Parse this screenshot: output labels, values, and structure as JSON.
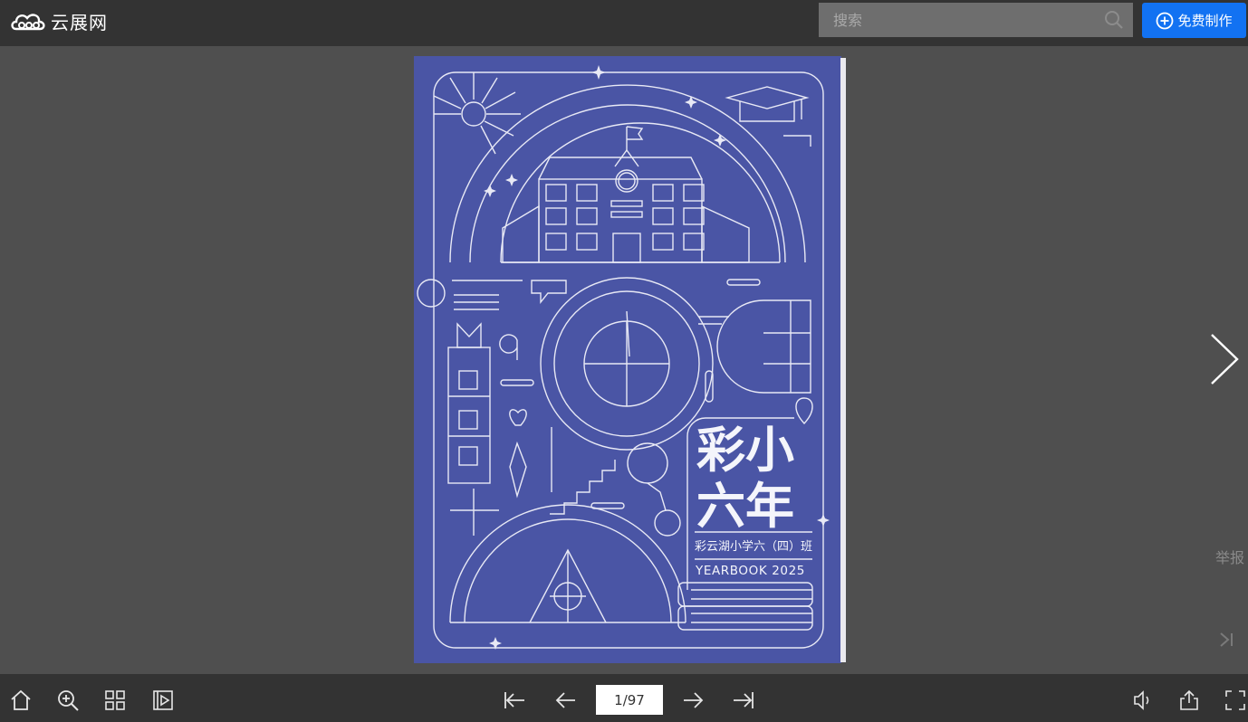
{
  "header": {
    "logo_text": "云展网",
    "search_placeholder": "搜索",
    "create_button_label": "免费制作"
  },
  "book": {
    "cover_title_line1": "彩小",
    "cover_title_line2": "六年",
    "cover_subtitle": "彩云湖小学六（四）班",
    "cover_caption": "YEARBOOK 2025",
    "cover_color": "#4a55a5",
    "line_color": "#e8e9f5"
  },
  "side": {
    "report_label": "举报"
  },
  "footer": {
    "page_indicator": "1/97"
  },
  "icons": [
    "cloud-logo-icon",
    "search-icon",
    "plus-circle-icon",
    "chevron-right-icon",
    "last-page-icon",
    "home-icon",
    "zoom-in-icon",
    "grid-icon",
    "play-icon",
    "first-page-icon",
    "prev-page-icon",
    "next-page-icon",
    "last-page-icon",
    "sound-icon",
    "share-icon",
    "fullscreen-icon"
  ]
}
